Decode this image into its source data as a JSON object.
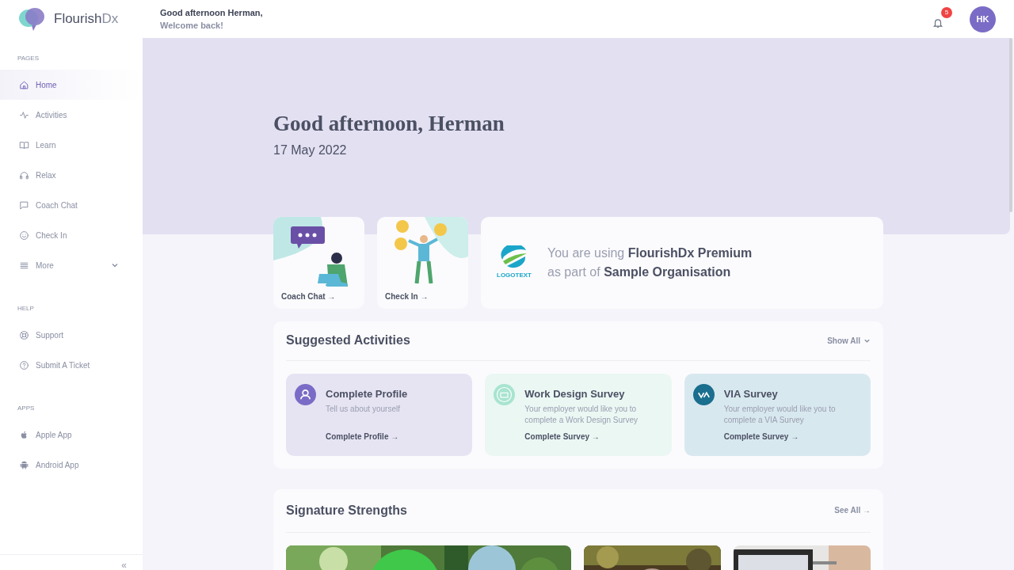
{
  "brand": {
    "name": "Flourish",
    "suffix": "Dx"
  },
  "header": {
    "greeting": "Good afternoon Herman,",
    "subtitle": "Welcome back!",
    "notification_count": "5",
    "avatar_initials": "HK"
  },
  "sidebar": {
    "sections": [
      {
        "title": "PAGES",
        "items": [
          {
            "label": "Home",
            "kind": "link",
            "selected": true
          },
          {
            "label": "Activities",
            "kind": "link",
            "selected": false
          },
          {
            "label": "Learn",
            "kind": "link",
            "selected": false
          },
          {
            "label": "Relax",
            "kind": "link",
            "selected": false
          },
          {
            "label": "Coach Chat",
            "kind": "link",
            "selected": false
          },
          {
            "label": "Check In",
            "kind": "link",
            "selected": false
          },
          {
            "label": "More",
            "kind": "group",
            "selected": false
          }
        ]
      },
      {
        "title": "HELP",
        "items": [
          {
            "label": "Support",
            "kind": "link",
            "selected": false
          },
          {
            "label": "Submit A Ticket",
            "kind": "link",
            "selected": false
          }
        ]
      },
      {
        "title": "APPS",
        "items": [
          {
            "label": "Apple App",
            "kind": "link",
            "selected": false
          },
          {
            "label": "Android App",
            "kind": "link",
            "selected": false
          }
        ]
      }
    ],
    "collapse": "«"
  },
  "hero": {
    "title": "Good afternoon, Herman",
    "date": "17 May 2022"
  },
  "quick_cards": [
    {
      "label": "Coach Chat",
      "arrow": "→"
    },
    {
      "label": "Check In",
      "arrow": "→"
    }
  ],
  "plan": {
    "logo_text": "LOGOTEXT",
    "lines": [
      "You are using **FlourishDx Premium**",
      "as part of **Sample Organisation**"
    ]
  },
  "suggested": {
    "title": "Suggested Activities",
    "action": "Show All",
    "cards": [
      {
        "title": "Complete Profile",
        "description": "Tell us about yourself",
        "link": "Complete Profile",
        "arrow": "→",
        "color": "#e6e4f3"
      },
      {
        "title": "Work Design Survey",
        "description": "Your employer would like you to complete a Work Design Survey",
        "link": "Complete Survey",
        "arrow": "→",
        "color": "#eaf7f3"
      },
      {
        "title": "VIA Survey",
        "description": "Your employer would like you to complete a VIA Survey",
        "link": "Complete Survey",
        "arrow": "→",
        "color": "#d8e8ef"
      }
    ]
  },
  "strengths": {
    "title": "Signature Strengths",
    "action": "See All",
    "arrow": "→"
  }
}
